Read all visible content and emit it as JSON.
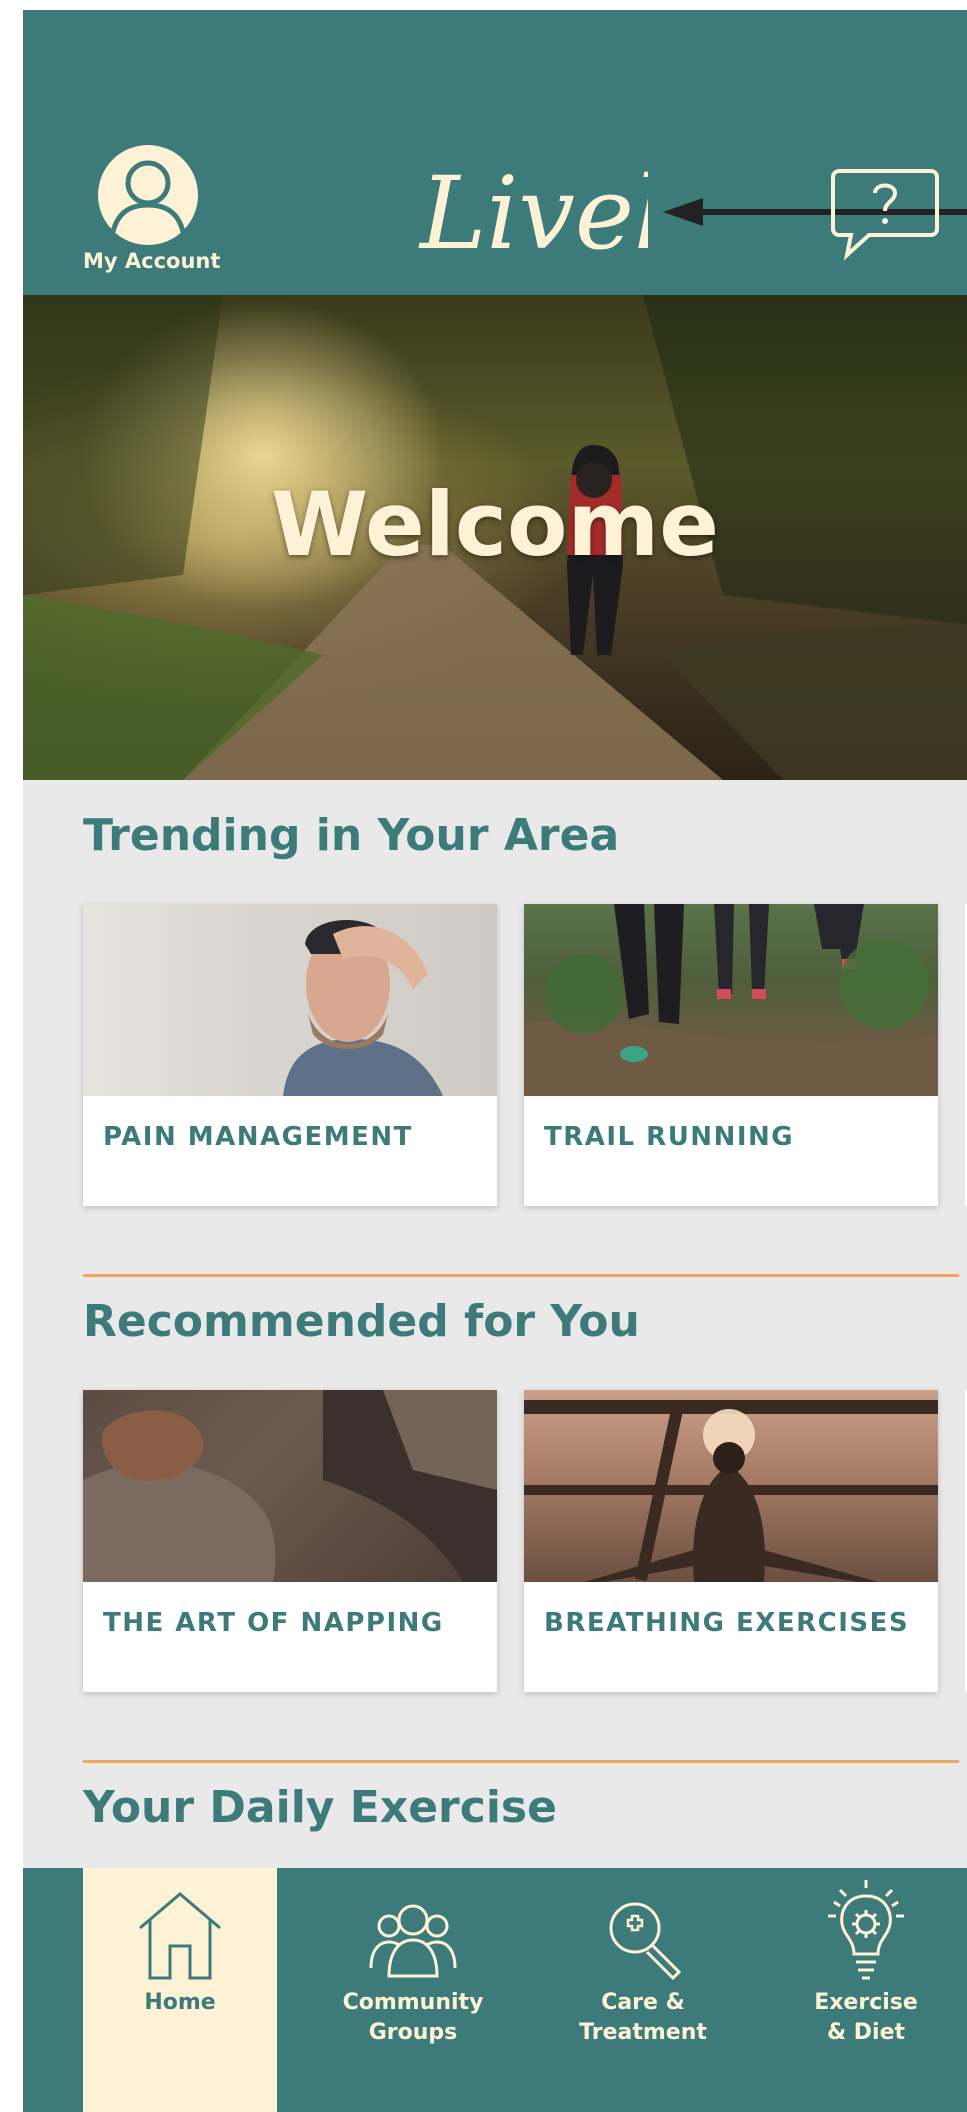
{
  "header": {
    "account_label": "My Account",
    "logo_text": "Lively"
  },
  "hero": {
    "heading": "Welcome"
  },
  "sections": {
    "trending": {
      "title": "Trending in Your Area",
      "cards": [
        {
          "title": "PAIN MANAGEMENT"
        },
        {
          "title": "TRAIL RUNNING"
        }
      ]
    },
    "recommended": {
      "title": "Recommended for You",
      "cards": [
        {
          "title": "THE ART OF NAPPING"
        },
        {
          "title": "BREATHING  EXERCISES"
        }
      ]
    },
    "daily": {
      "title": "Your Daily Exercise"
    }
  },
  "nav": {
    "items": [
      {
        "label": "Home",
        "icon": "home-icon",
        "active": true
      },
      {
        "label": "Community\nGroups",
        "icon": "community-icon"
      },
      {
        "label": "Care &\nTreatment",
        "icon": "care-icon"
      },
      {
        "label": "Exercise\n& Diet",
        "icon": "lightbulb-gear-icon"
      }
    ]
  },
  "colors": {
    "primary": "#3c7b79",
    "cream": "#fdf2d5",
    "accent": "#f2a55b",
    "background": "#e9e9e9"
  }
}
